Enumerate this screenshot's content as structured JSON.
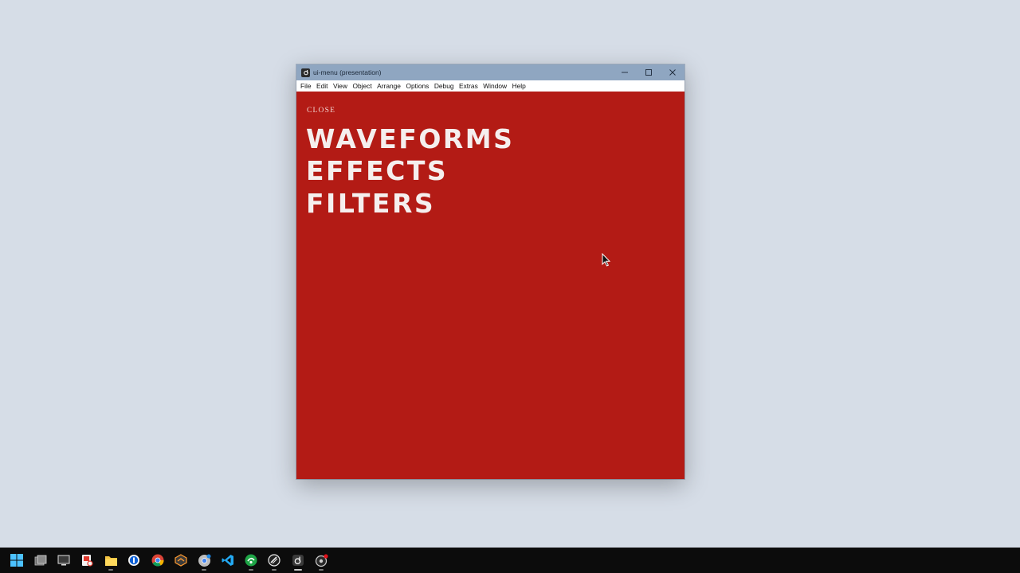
{
  "window": {
    "title": "ui-menu (presentation)",
    "app_icon": "app-logo-icon",
    "controls": [
      "minimize-icon",
      "maximize-icon",
      "close-icon"
    ]
  },
  "menubar": {
    "items": [
      "File",
      "Edit",
      "View",
      "Object",
      "Arrange",
      "Options",
      "Debug",
      "Extras",
      "Window",
      "Help"
    ]
  },
  "content": {
    "background": "#b31b15",
    "close_label": "CLOSE",
    "menu": [
      "WAVEFORMS",
      "EFFECTS",
      "FILTERS"
    ]
  },
  "taskbar": {
    "icons": [
      "start-icon",
      "task-view-icon",
      "desktop-icon",
      "snipping-tool-icon",
      "file-explorer-icon",
      "password-manager-icon",
      "chrome-icon",
      "sublime-merge-icon",
      "chrome-dev-icon",
      "vscode-icon",
      "green-app-icon",
      "terminal-app-icon",
      "presentation-app-icon",
      "recorder-icon"
    ],
    "active": "presentation-app-icon"
  }
}
